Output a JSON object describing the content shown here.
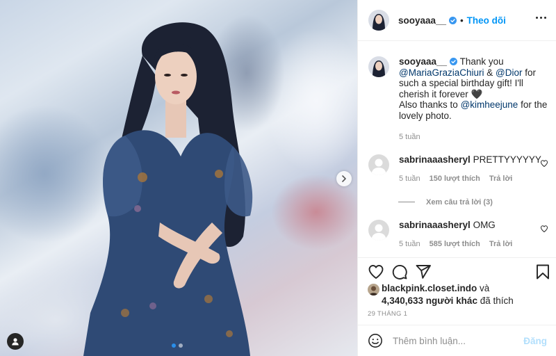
{
  "post": {
    "carousel_index": 1,
    "carousel_count": 2,
    "icons": {
      "next": "chevron-right-icon",
      "tag": "user-tag-icon"
    }
  },
  "header": {
    "username": "sooyaaa__",
    "verified": true,
    "separator": "•",
    "follow_label": "Theo dõi",
    "more_icon": "more-options-icon"
  },
  "caption": {
    "username": "sooyaaa__",
    "text_1": " Thank you ",
    "mention_1": "@MariaGraziaChiuri",
    "text_2": " & ",
    "mention_2": "@Dior",
    "text_3": " for such a special birthday gift! I'll cherish it forever 🖤",
    "text_4": "Also thanks to ",
    "mention_3": "@kimheejune",
    "text_5": " for the lovely photo.",
    "time": "5 tuần"
  },
  "comments": [
    {
      "username": "sabrinaaasheryl",
      "text": " PRETTYYYYYY",
      "time": "5 tuần",
      "likes": "150 lượt thích",
      "reply_label": "Trả lời",
      "view_replies": "Xem câu trả lời (3)"
    },
    {
      "username": "sabrinaaasheryl",
      "text": " OMG",
      "time": "5 tuần",
      "likes": "585 lượt thích",
      "reply_label": "Trả lời"
    }
  ],
  "actions": {
    "icons": [
      "heart-icon",
      "comment-icon",
      "share-icon",
      "bookmark-icon"
    ]
  },
  "likes": {
    "first_liker": "blackpink.closet.indo",
    "and": " và",
    "others": "4,340,633 người khác",
    "suffix": " đã thích"
  },
  "date": "29 THÁNG 1",
  "add_comment": {
    "placeholder": "Thêm bình luận...",
    "post_label": "Đăng"
  },
  "colors": {
    "accent": "#0095f6",
    "mention": "#00376b",
    "muted": "#8e8e8e",
    "post_disabled": "#b2dffc"
  }
}
